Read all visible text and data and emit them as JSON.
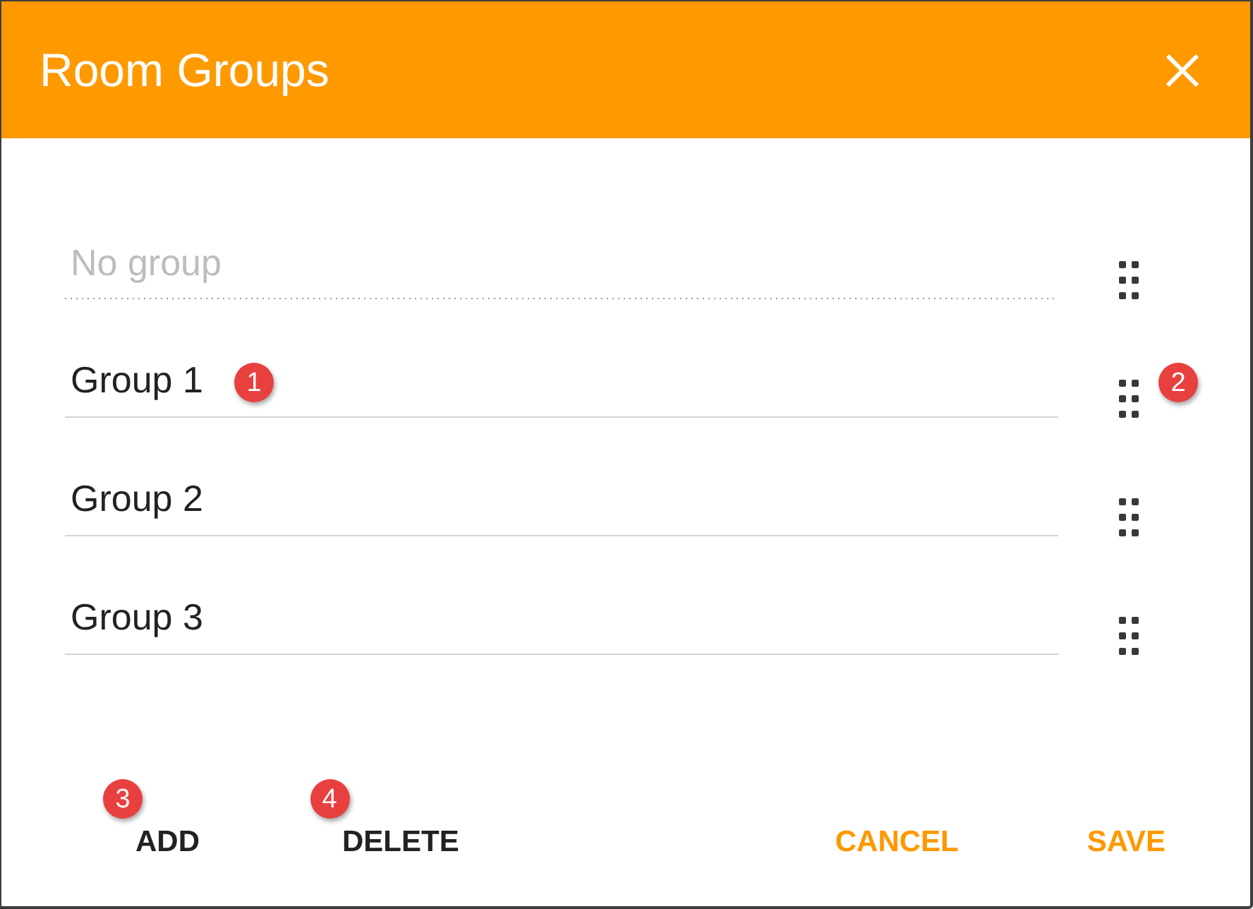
{
  "dialog": {
    "title": "Room Groups"
  },
  "groups": [
    {
      "value": "No group",
      "disabled": true
    },
    {
      "value": "Group 1",
      "disabled": false,
      "callout": "1",
      "handle_callout": "2"
    },
    {
      "value": "Group 2",
      "disabled": false
    },
    {
      "value": "Group 3",
      "disabled": false
    }
  ],
  "footer": {
    "left": [
      {
        "label": "ADD",
        "kind": "plain",
        "callout": "3"
      },
      {
        "label": "DELETE",
        "kind": "plain",
        "callout": "4"
      }
    ],
    "right": [
      {
        "label": "CANCEL",
        "kind": "accent"
      },
      {
        "label": "SAVE",
        "kind": "accent"
      }
    ]
  }
}
